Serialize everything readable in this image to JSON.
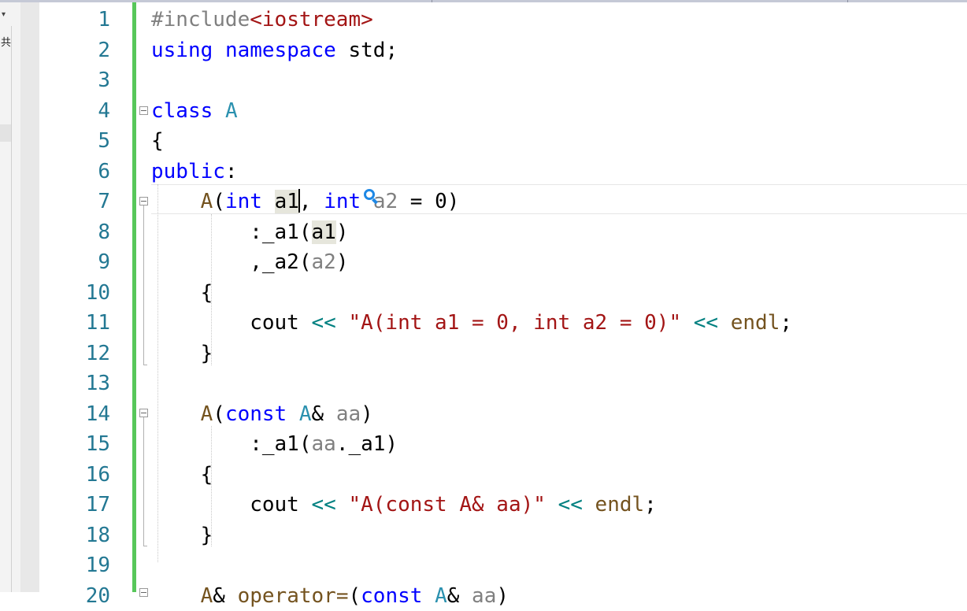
{
  "left_panel": {
    "dropdown_glyph": "▾",
    "label": "共"
  },
  "editor": {
    "lines": [
      {
        "n": "1",
        "t": [
          [
            "pp",
            "#include"
          ],
          [
            "inc",
            "<iostream>"
          ]
        ]
      },
      {
        "n": "2",
        "t": [
          [
            "kw",
            "using"
          ],
          [
            "plain",
            " "
          ],
          [
            "kw",
            "namespace"
          ],
          [
            "plain",
            " std;"
          ]
        ]
      },
      {
        "n": "3",
        "t": []
      },
      {
        "n": "4",
        "t": [
          [
            "kw",
            "class"
          ],
          [
            "plain",
            " "
          ],
          [
            "type",
            "A"
          ]
        ]
      },
      {
        "n": "5",
        "t": [
          [
            "plain",
            "{"
          ]
        ]
      },
      {
        "n": "6",
        "t": [
          [
            "kw",
            "public"
          ],
          [
            "plain",
            ":"
          ]
        ]
      },
      {
        "n": "7",
        "t": [
          [
            "plain",
            "    "
          ],
          [
            "fn",
            "A"
          ],
          [
            "plain",
            "("
          ],
          [
            "kw",
            "int"
          ],
          [
            "plain",
            " "
          ],
          [
            "hl",
            "a1"
          ],
          [
            "caret",
            ""
          ],
          [
            "plain",
            ", "
          ],
          [
            "kw",
            "int"
          ],
          [
            "plain",
            " "
          ],
          [
            "param",
            "a2"
          ],
          [
            "plain",
            " = 0)"
          ]
        ]
      },
      {
        "n": "8",
        "t": [
          [
            "plain",
            "        :_a1("
          ],
          [
            "hl",
            "a1"
          ],
          [
            "plain",
            ")"
          ]
        ]
      },
      {
        "n": "9",
        "t": [
          [
            "plain",
            "        ,_a2("
          ],
          [
            "param",
            "a2"
          ],
          [
            "plain",
            ")"
          ]
        ]
      },
      {
        "n": "10",
        "t": [
          [
            "plain",
            "    {"
          ]
        ]
      },
      {
        "n": "11",
        "t": [
          [
            "plain",
            "        cout "
          ],
          [
            "op",
            "<<"
          ],
          [
            "plain",
            " "
          ],
          [
            "str",
            "\"A(int a1 = 0, int a2 = 0)\""
          ],
          [
            "plain",
            " "
          ],
          [
            "op",
            "<<"
          ],
          [
            "plain",
            " "
          ],
          [
            "fn",
            "endl"
          ],
          [
            "plain",
            ";"
          ]
        ]
      },
      {
        "n": "12",
        "t": [
          [
            "plain",
            "    }"
          ]
        ]
      },
      {
        "n": "13",
        "t": []
      },
      {
        "n": "14",
        "t": [
          [
            "plain",
            "    "
          ],
          [
            "fn",
            "A"
          ],
          [
            "plain",
            "("
          ],
          [
            "kw",
            "const"
          ],
          [
            "plain",
            " "
          ],
          [
            "type",
            "A"
          ],
          [
            "plain",
            "& "
          ],
          [
            "param",
            "aa"
          ],
          [
            "plain",
            ")"
          ]
        ]
      },
      {
        "n": "15",
        "t": [
          [
            "plain",
            "        :_a1("
          ],
          [
            "param",
            "aa"
          ],
          [
            "plain",
            "._a1)"
          ]
        ]
      },
      {
        "n": "16",
        "t": [
          [
            "plain",
            "    {"
          ]
        ]
      },
      {
        "n": "17",
        "t": [
          [
            "plain",
            "        cout "
          ],
          [
            "op",
            "<<"
          ],
          [
            "plain",
            " "
          ],
          [
            "str",
            "\"A(const A& aa)\""
          ],
          [
            "plain",
            " "
          ],
          [
            "op",
            "<<"
          ],
          [
            "plain",
            " "
          ],
          [
            "fn",
            "endl"
          ],
          [
            "plain",
            ";"
          ]
        ]
      },
      {
        "n": "18",
        "t": [
          [
            "plain",
            "    }"
          ]
        ]
      },
      {
        "n": "19",
        "t": []
      },
      {
        "n": "20",
        "t": [
          [
            "plain",
            "    "
          ],
          [
            "fn",
            "A"
          ],
          [
            "plain",
            "& "
          ],
          [
            "fn",
            "operator="
          ],
          [
            "plain",
            "("
          ],
          [
            "kw",
            "const"
          ],
          [
            "plain",
            " "
          ],
          [
            "type",
            "A"
          ],
          [
            "plain",
            "& "
          ],
          [
            "param",
            "aa"
          ],
          [
            "plain",
            ")"
          ]
        ]
      }
    ]
  }
}
